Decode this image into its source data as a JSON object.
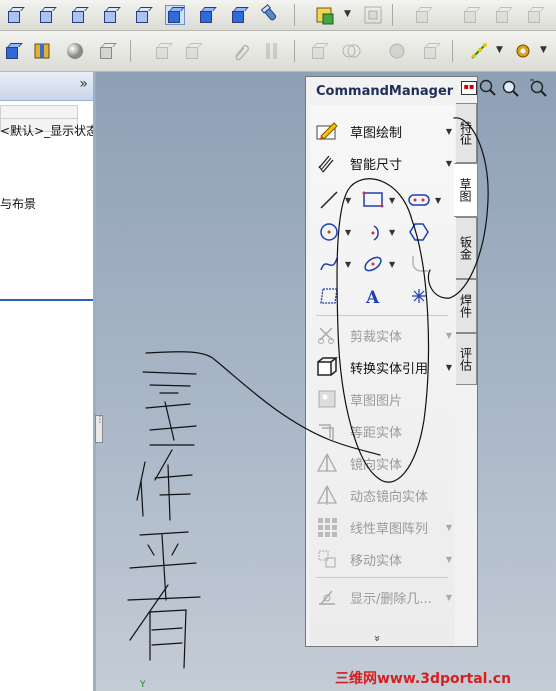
{
  "left_panel": {
    "expand_icon": "»",
    "config_text": "<默认>_显示状态",
    "scene_text": "与布景"
  },
  "command_manager": {
    "title": "CommandManager",
    "rows": [
      {
        "label": "草图绘制",
        "icon": "sketch-pencil-icon",
        "disabled": false
      },
      {
        "label": "智能尺寸",
        "icon": "smart-dimension-icon",
        "disabled": false
      },
      {
        "label": "剪裁实体",
        "icon": "trim-icon",
        "disabled": true
      },
      {
        "label": "转换实体引用",
        "icon": "convert-entities-icon",
        "disabled": false
      },
      {
        "label": "草图图片",
        "icon": "sketch-picture-icon",
        "disabled": true
      },
      {
        "label": "等距实体",
        "icon": "offset-icon",
        "disabled": true
      },
      {
        "label": "镜向实体",
        "icon": "mirror-icon",
        "disabled": true
      },
      {
        "label": "动态镜向实体",
        "icon": "dynamic-mirror-icon",
        "disabled": true
      },
      {
        "label": "线性草图阵列",
        "icon": "linear-pattern-icon",
        "disabled": true
      },
      {
        "label": "移动实体",
        "icon": "move-entities-icon",
        "disabled": true
      },
      {
        "label": "显示/删除几...",
        "icon": "display-delete-relations-icon",
        "disabled": true
      }
    ],
    "tabs": [
      "特征",
      "草图",
      "钣金",
      "焊件",
      "评估"
    ],
    "more_glyph": "»"
  },
  "axis_label": "Y",
  "watermark": {
    "cn": "三维网",
    "url": "www.3dportal.cn"
  },
  "colors": {
    "accent": "#2a5fb8",
    "graphics_bg": "#9aa9bb",
    "watermark": "#d42020"
  }
}
